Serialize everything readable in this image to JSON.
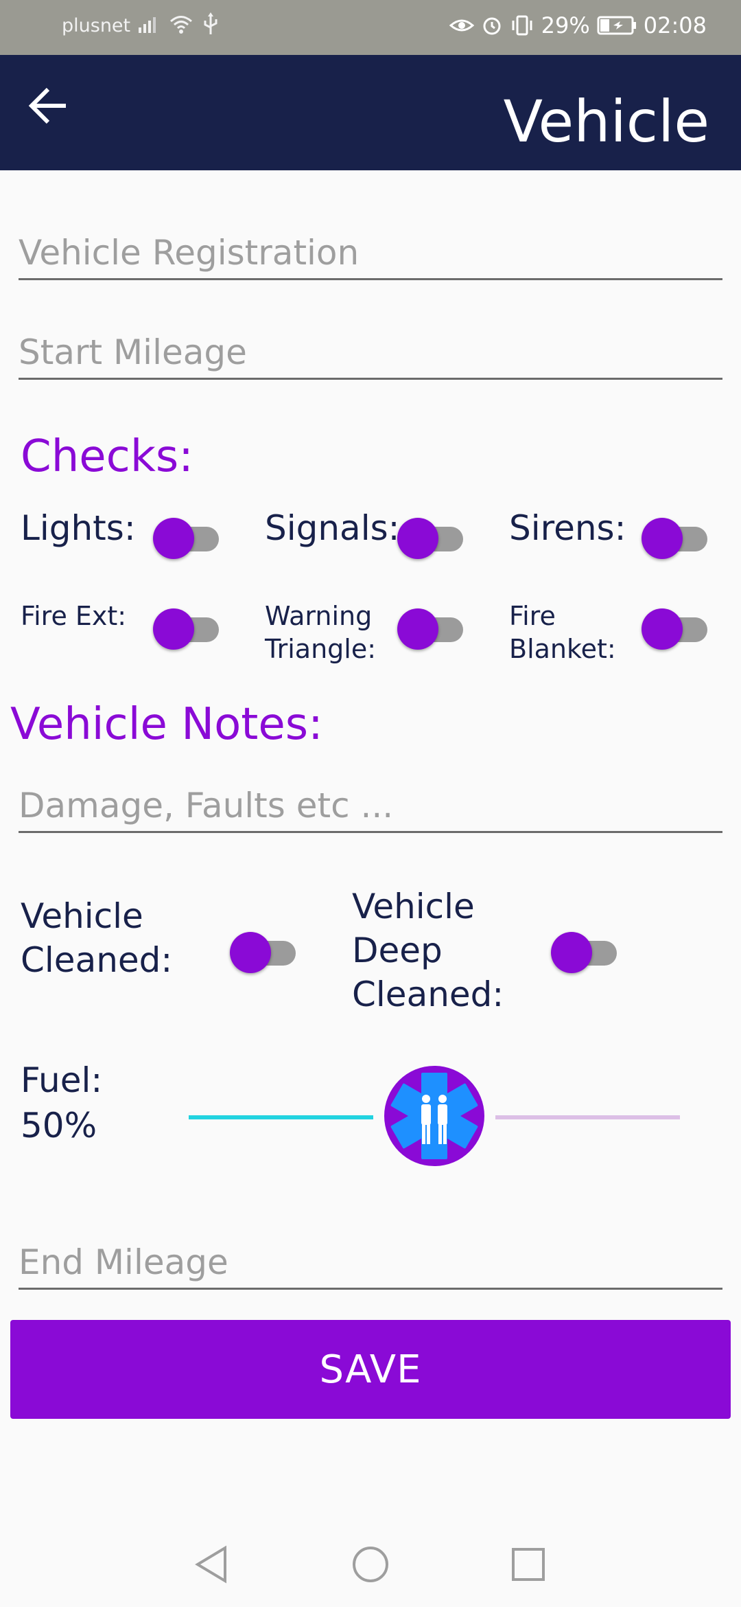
{
  "status_bar": {
    "carrier": "plusnet",
    "battery": "29%",
    "time": "02:08"
  },
  "app_bar": {
    "title": "Vehicle"
  },
  "form": {
    "registration_placeholder": "Vehicle Registration",
    "start_mileage_placeholder": "Start Mileage",
    "checks_title": "Checks:",
    "checks": [
      {
        "label": "Lights:"
      },
      {
        "label": "Signals:"
      },
      {
        "label": "Sirens:"
      },
      {
        "label": "Fire Ext:"
      },
      {
        "label_line1": "Warning",
        "label_line2": "Triangle:"
      },
      {
        "label_line1": "Fire",
        "label_line2": "Blanket:"
      }
    ],
    "notes_title": "Vehicle Notes:",
    "notes_placeholder": "Damage, Faults etc ...",
    "cleaned": {
      "line1": "Vehicle",
      "line2": "Cleaned:"
    },
    "deep_cleaned": {
      "line1": "Vehicle",
      "line2": "Deep",
      "line3": "Cleaned:"
    },
    "fuel": {
      "label": "Fuel:",
      "value_text": "50%",
      "value": 0.5
    },
    "end_mileage_placeholder": "End Mileage",
    "save_label": "SAVE"
  },
  "colors": {
    "accent": "#8a0ad6",
    "navy": "#18214a",
    "slider_active": "#22d3e0"
  }
}
